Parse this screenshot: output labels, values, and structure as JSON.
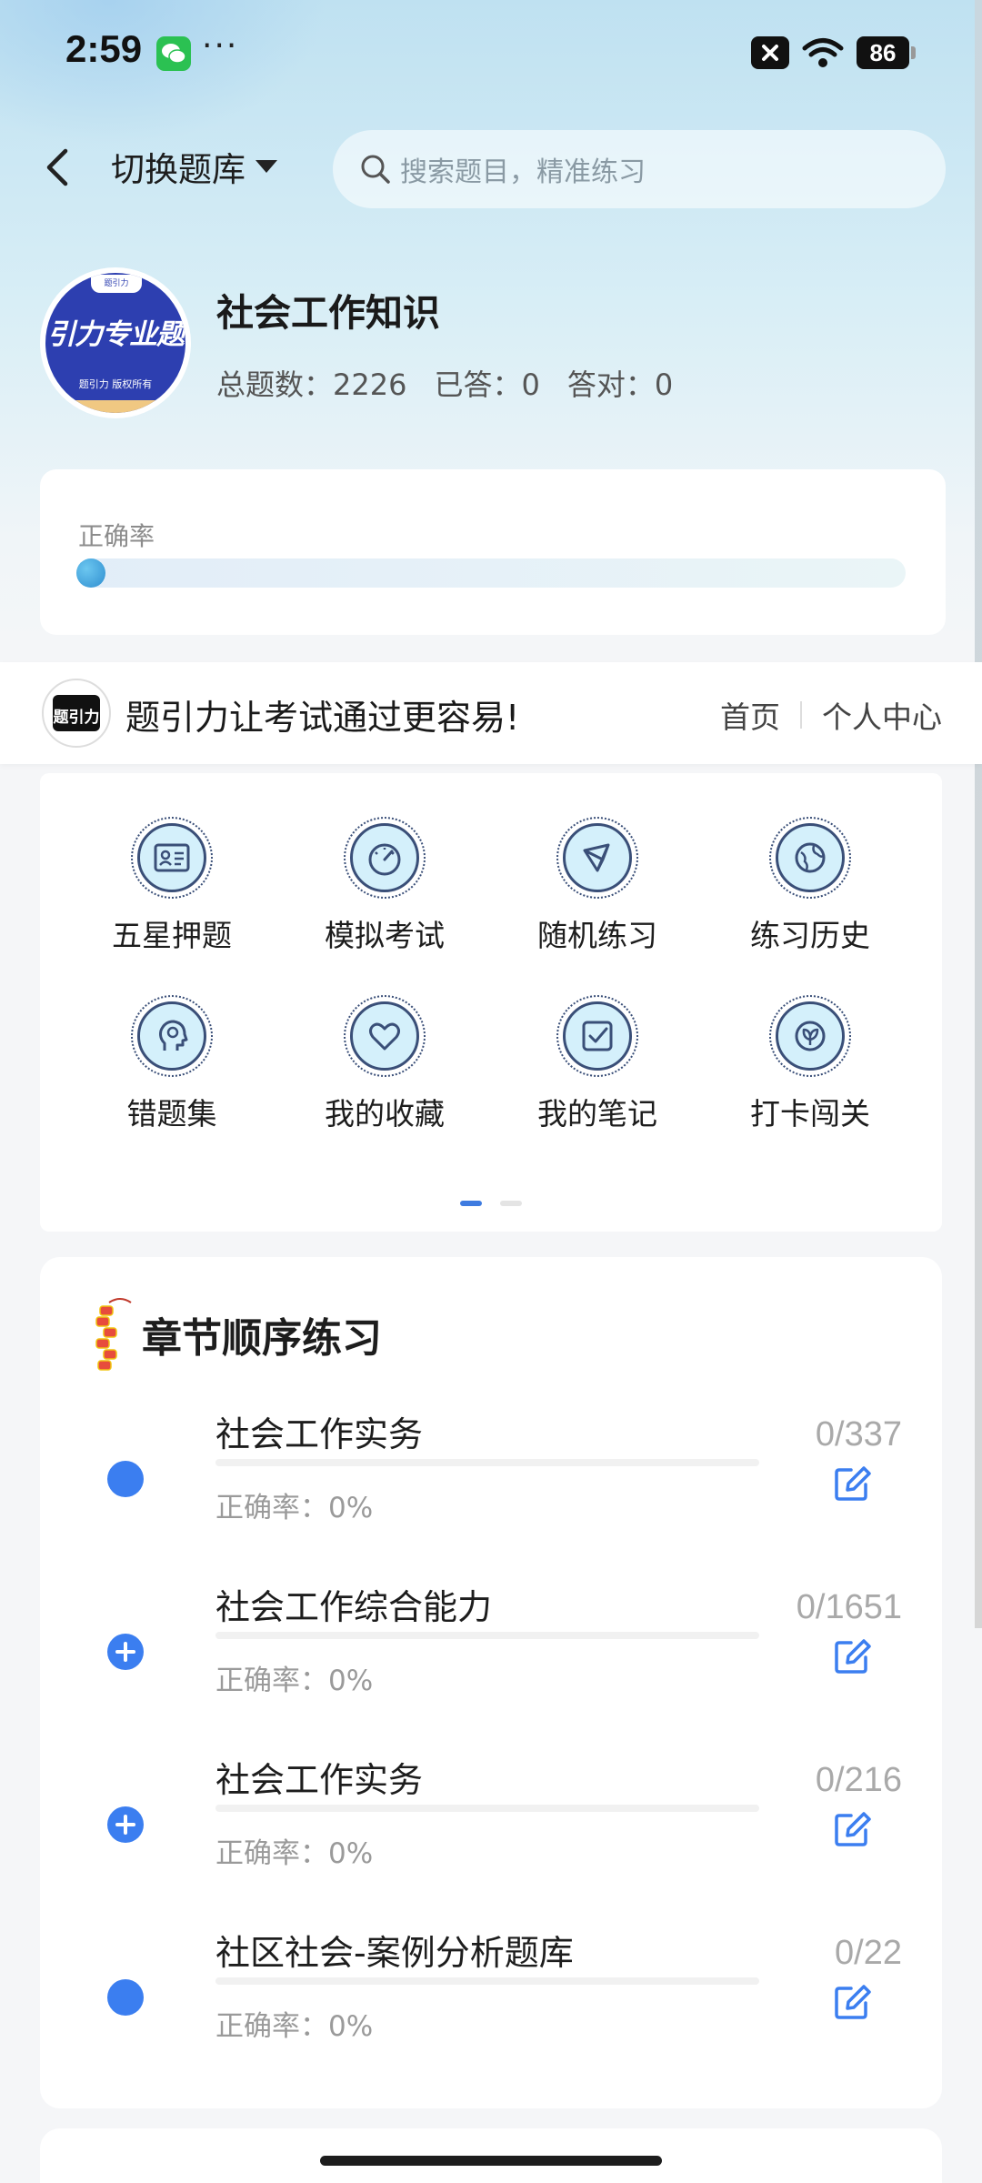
{
  "status": {
    "time": "2:59",
    "dots": "···",
    "battery": "86"
  },
  "header": {
    "switch_label": "切换题库",
    "search_placeholder": "搜索题目，精准练习"
  },
  "bank": {
    "logo_tag": "题引力",
    "logo_text": "引力专业题",
    "logo_caption": "题引力 版权所有",
    "title": "社会工作知识",
    "total": "总题数：2226",
    "answered": "已答：0",
    "correct": "答对：0"
  },
  "accuracy": {
    "label": "正确率",
    "value": 0
  },
  "banner": {
    "logo_glyph": "题引力",
    "text": "题引力让考试通过更容易!",
    "home_link": "首页",
    "profile_link": "个人中心"
  },
  "features": [
    {
      "label": "五星押题",
      "icon": "id-card-icon"
    },
    {
      "label": "模拟考试",
      "icon": "gauge-icon"
    },
    {
      "label": "随机练习",
      "icon": "network-icon"
    },
    {
      "label": "练习历史",
      "icon": "globe-icon"
    },
    {
      "label": "错题集",
      "icon": "head-icon"
    },
    {
      "label": "我的收藏",
      "icon": "heart-icon"
    },
    {
      "label": "我的笔记",
      "icon": "note-check-icon"
    },
    {
      "label": "打卡闯关",
      "icon": "leaf-icon"
    }
  ],
  "pager": {
    "pages": 2,
    "active": 0
  },
  "chapters": {
    "title": "章节顺序练习",
    "items": [
      {
        "name": "社会工作实务",
        "accuracy": "正确率：0%",
        "count": "0/337",
        "expandable": false,
        "progress": 0
      },
      {
        "name": "社会工作综合能力",
        "accuracy": "正确率：0%",
        "count": "0/1651",
        "expandable": true,
        "progress": 0
      },
      {
        "name": "社会工作实务",
        "accuracy": "正确率：0%",
        "count": "0/216",
        "expandable": true,
        "progress": 0
      },
      {
        "name": "社区社会-案例分析题库",
        "accuracy": "正确率：0%",
        "count": "0/22",
        "expandable": false,
        "progress": 0
      }
    ]
  },
  "colors": {
    "accent": "#3b7ef0",
    "icon_fill": "#d4f0fb",
    "icon_stroke": "#3a4f78"
  }
}
